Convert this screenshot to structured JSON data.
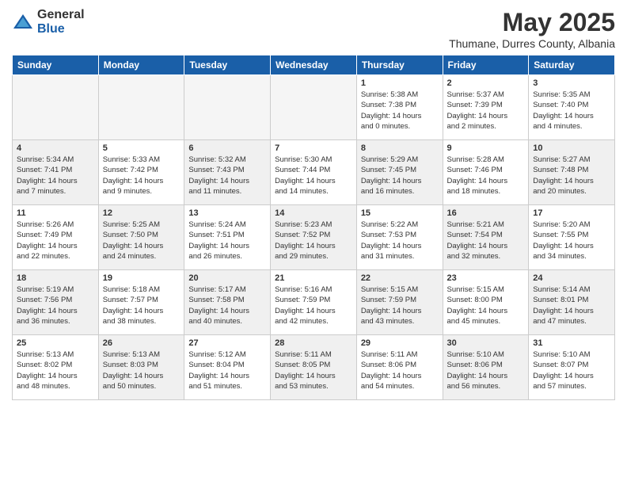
{
  "header": {
    "logo_general": "General",
    "logo_blue": "Blue",
    "title": "May 2025",
    "subtitle": "Thumane, Durres County, Albania"
  },
  "days_of_week": [
    "Sunday",
    "Monday",
    "Tuesday",
    "Wednesday",
    "Thursday",
    "Friday",
    "Saturday"
  ],
  "weeks": [
    [
      {
        "day": "",
        "empty": true
      },
      {
        "day": "",
        "empty": true
      },
      {
        "day": "",
        "empty": true
      },
      {
        "day": "",
        "empty": true
      },
      {
        "day": "1",
        "info": "Sunrise: 5:38 AM\nSunset: 7:38 PM\nDaylight: 14 hours\nand 0 minutes."
      },
      {
        "day": "2",
        "info": "Sunrise: 5:37 AM\nSunset: 7:39 PM\nDaylight: 14 hours\nand 2 minutes."
      },
      {
        "day": "3",
        "info": "Sunrise: 5:35 AM\nSunset: 7:40 PM\nDaylight: 14 hours\nand 4 minutes."
      }
    ],
    [
      {
        "day": "4",
        "info": "Sunrise: 5:34 AM\nSunset: 7:41 PM\nDaylight: 14 hours\nand 7 minutes.",
        "shaded": true
      },
      {
        "day": "5",
        "info": "Sunrise: 5:33 AM\nSunset: 7:42 PM\nDaylight: 14 hours\nand 9 minutes."
      },
      {
        "day": "6",
        "info": "Sunrise: 5:32 AM\nSunset: 7:43 PM\nDaylight: 14 hours\nand 11 minutes.",
        "shaded": true
      },
      {
        "day": "7",
        "info": "Sunrise: 5:30 AM\nSunset: 7:44 PM\nDaylight: 14 hours\nand 14 minutes."
      },
      {
        "day": "8",
        "info": "Sunrise: 5:29 AM\nSunset: 7:45 PM\nDaylight: 14 hours\nand 16 minutes.",
        "shaded": true
      },
      {
        "day": "9",
        "info": "Sunrise: 5:28 AM\nSunset: 7:46 PM\nDaylight: 14 hours\nand 18 minutes."
      },
      {
        "day": "10",
        "info": "Sunrise: 5:27 AM\nSunset: 7:48 PM\nDaylight: 14 hours\nand 20 minutes.",
        "shaded": true
      }
    ],
    [
      {
        "day": "11",
        "info": "Sunrise: 5:26 AM\nSunset: 7:49 PM\nDaylight: 14 hours\nand 22 minutes."
      },
      {
        "day": "12",
        "info": "Sunrise: 5:25 AM\nSunset: 7:50 PM\nDaylight: 14 hours\nand 24 minutes.",
        "shaded": true
      },
      {
        "day": "13",
        "info": "Sunrise: 5:24 AM\nSunset: 7:51 PM\nDaylight: 14 hours\nand 26 minutes."
      },
      {
        "day": "14",
        "info": "Sunrise: 5:23 AM\nSunset: 7:52 PM\nDaylight: 14 hours\nand 29 minutes.",
        "shaded": true
      },
      {
        "day": "15",
        "info": "Sunrise: 5:22 AM\nSunset: 7:53 PM\nDaylight: 14 hours\nand 31 minutes."
      },
      {
        "day": "16",
        "info": "Sunrise: 5:21 AM\nSunset: 7:54 PM\nDaylight: 14 hours\nand 32 minutes.",
        "shaded": true
      },
      {
        "day": "17",
        "info": "Sunrise: 5:20 AM\nSunset: 7:55 PM\nDaylight: 14 hours\nand 34 minutes."
      }
    ],
    [
      {
        "day": "18",
        "info": "Sunrise: 5:19 AM\nSunset: 7:56 PM\nDaylight: 14 hours\nand 36 minutes.",
        "shaded": true
      },
      {
        "day": "19",
        "info": "Sunrise: 5:18 AM\nSunset: 7:57 PM\nDaylight: 14 hours\nand 38 minutes."
      },
      {
        "day": "20",
        "info": "Sunrise: 5:17 AM\nSunset: 7:58 PM\nDaylight: 14 hours\nand 40 minutes.",
        "shaded": true
      },
      {
        "day": "21",
        "info": "Sunrise: 5:16 AM\nSunset: 7:59 PM\nDaylight: 14 hours\nand 42 minutes."
      },
      {
        "day": "22",
        "info": "Sunrise: 5:15 AM\nSunset: 7:59 PM\nDaylight: 14 hours\nand 43 minutes.",
        "shaded": true
      },
      {
        "day": "23",
        "info": "Sunrise: 5:15 AM\nSunset: 8:00 PM\nDaylight: 14 hours\nand 45 minutes."
      },
      {
        "day": "24",
        "info": "Sunrise: 5:14 AM\nSunset: 8:01 PM\nDaylight: 14 hours\nand 47 minutes.",
        "shaded": true
      }
    ],
    [
      {
        "day": "25",
        "info": "Sunrise: 5:13 AM\nSunset: 8:02 PM\nDaylight: 14 hours\nand 48 minutes."
      },
      {
        "day": "26",
        "info": "Sunrise: 5:13 AM\nSunset: 8:03 PM\nDaylight: 14 hours\nand 50 minutes.",
        "shaded": true
      },
      {
        "day": "27",
        "info": "Sunrise: 5:12 AM\nSunset: 8:04 PM\nDaylight: 14 hours\nand 51 minutes."
      },
      {
        "day": "28",
        "info": "Sunrise: 5:11 AM\nSunset: 8:05 PM\nDaylight: 14 hours\nand 53 minutes.",
        "shaded": true
      },
      {
        "day": "29",
        "info": "Sunrise: 5:11 AM\nSunset: 8:06 PM\nDaylight: 14 hours\nand 54 minutes."
      },
      {
        "day": "30",
        "info": "Sunrise: 5:10 AM\nSunset: 8:06 PM\nDaylight: 14 hours\nand 56 minutes.",
        "shaded": true
      },
      {
        "day": "31",
        "info": "Sunrise: 5:10 AM\nSunset: 8:07 PM\nDaylight: 14 hours\nand 57 minutes."
      }
    ]
  ]
}
